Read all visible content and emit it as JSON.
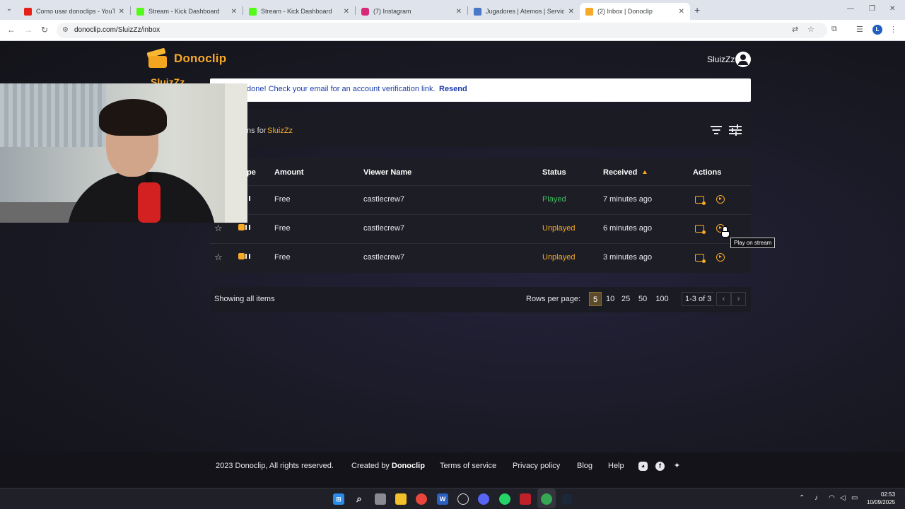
{
  "browser": {
    "tabs": [
      {
        "title": "Como usar donoclips - YouTube",
        "favicon_color": "#e62117",
        "active": false
      },
      {
        "title": "Stream - Kick Dashboard",
        "favicon_color": "#53fc18",
        "active": false
      },
      {
        "title": "Stream - Kick Dashboard",
        "favicon_color": "#53fc18",
        "active": false
      },
      {
        "title": "(7) Instagram",
        "favicon_color": "#d62976",
        "active": false
      },
      {
        "title": "Jugadores | Atemos | Servidor de",
        "favicon_color": "#4a78c9",
        "active": false
      },
      {
        "title": "(2) Inbox | Donoclip",
        "favicon_color": "#f7a928",
        "active": true
      }
    ],
    "url": "donoclip.com/SluizZz/inbox",
    "profile_initial": "L"
  },
  "header": {
    "brand": "Donoclip",
    "brand_sub": "SluizZz",
    "username": "SluizZz",
    "colors": {
      "accent": "#f7a928"
    }
  },
  "banner": {
    "text": "done! Check your email for an account verification link.",
    "link": "Resend"
  },
  "panel": {
    "title_prefix": "ns for",
    "title_user": "SluizZz"
  },
  "table": {
    "columns": [
      "pe",
      "Amount",
      "Viewer Name",
      "Status",
      "Received",
      "Actions"
    ],
    "rows": [
      {
        "amount": "Free",
        "viewer": "castlecrew7",
        "status": "Played",
        "received": "7 minutes ago"
      },
      {
        "amount": "Free",
        "viewer": "castlecrew7",
        "status": "Unplayed",
        "received": "6 minutes ago"
      },
      {
        "amount": "Free",
        "viewer": "castlecrew7",
        "status": "Unplayed",
        "received": "3 minutes ago"
      }
    ]
  },
  "tooltip": "Play on stream",
  "pagination": {
    "showing": "Showing all items",
    "rows_label": "Rows per page:",
    "options": [
      "5",
      "10",
      "25",
      "50",
      "100"
    ],
    "selected": "5",
    "range": "1-3 of 3"
  },
  "footer": {
    "copyright": "2023 Donoclip, All rights reserved.",
    "created_prefix": "Created by",
    "created_brand": "Donoclip",
    "terms": "Terms of service",
    "privacy": "Privacy policy",
    "blog": "Blog",
    "help": "Help",
    "social": [
      "discord-icon",
      "facebook-icon",
      "twitter-icon"
    ]
  },
  "taskbar": {
    "time": "02:53",
    "date": "10/09/2025"
  }
}
